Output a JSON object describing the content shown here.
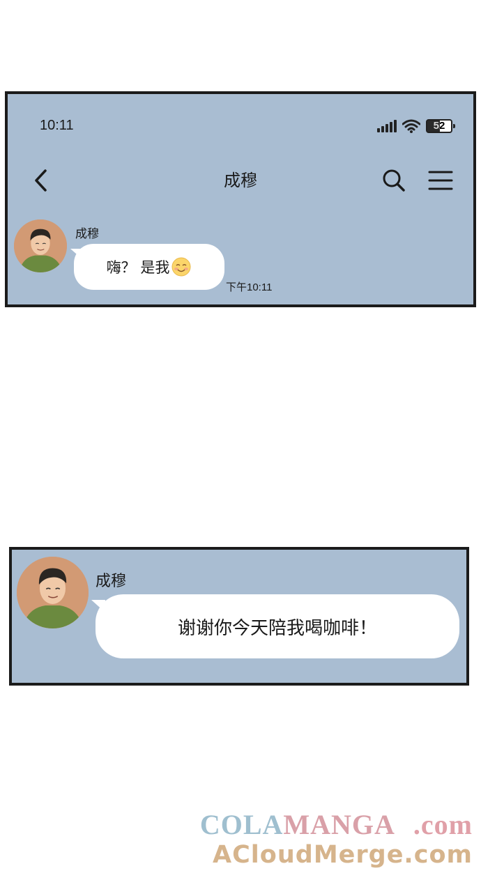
{
  "status_bar": {
    "time": "10:11",
    "battery": "52",
    "battery_level_percent": 52
  },
  "header": {
    "title": "成穆",
    "back_icon": "chevron-left-icon",
    "search_icon": "search-icon",
    "menu_icon": "hamburger-menu-icon"
  },
  "panel1": {
    "sender": "成穆",
    "message": "嗨？ 是我",
    "emoji": "smiling-face-emoji",
    "timestamp": "下午10:11"
  },
  "panel2": {
    "sender": "成穆",
    "message": "谢谢你今天陪我喝咖啡！"
  },
  "watermark": {
    "line1_part1": "COLA",
    "line1_part2": "MANGA",
    "line1_part3": ".com",
    "line2": "ACloudMerge.com"
  },
  "colors": {
    "chat_background": "#a9bdd2",
    "bubble": "#ffffff",
    "border": "#1b1b1b"
  }
}
